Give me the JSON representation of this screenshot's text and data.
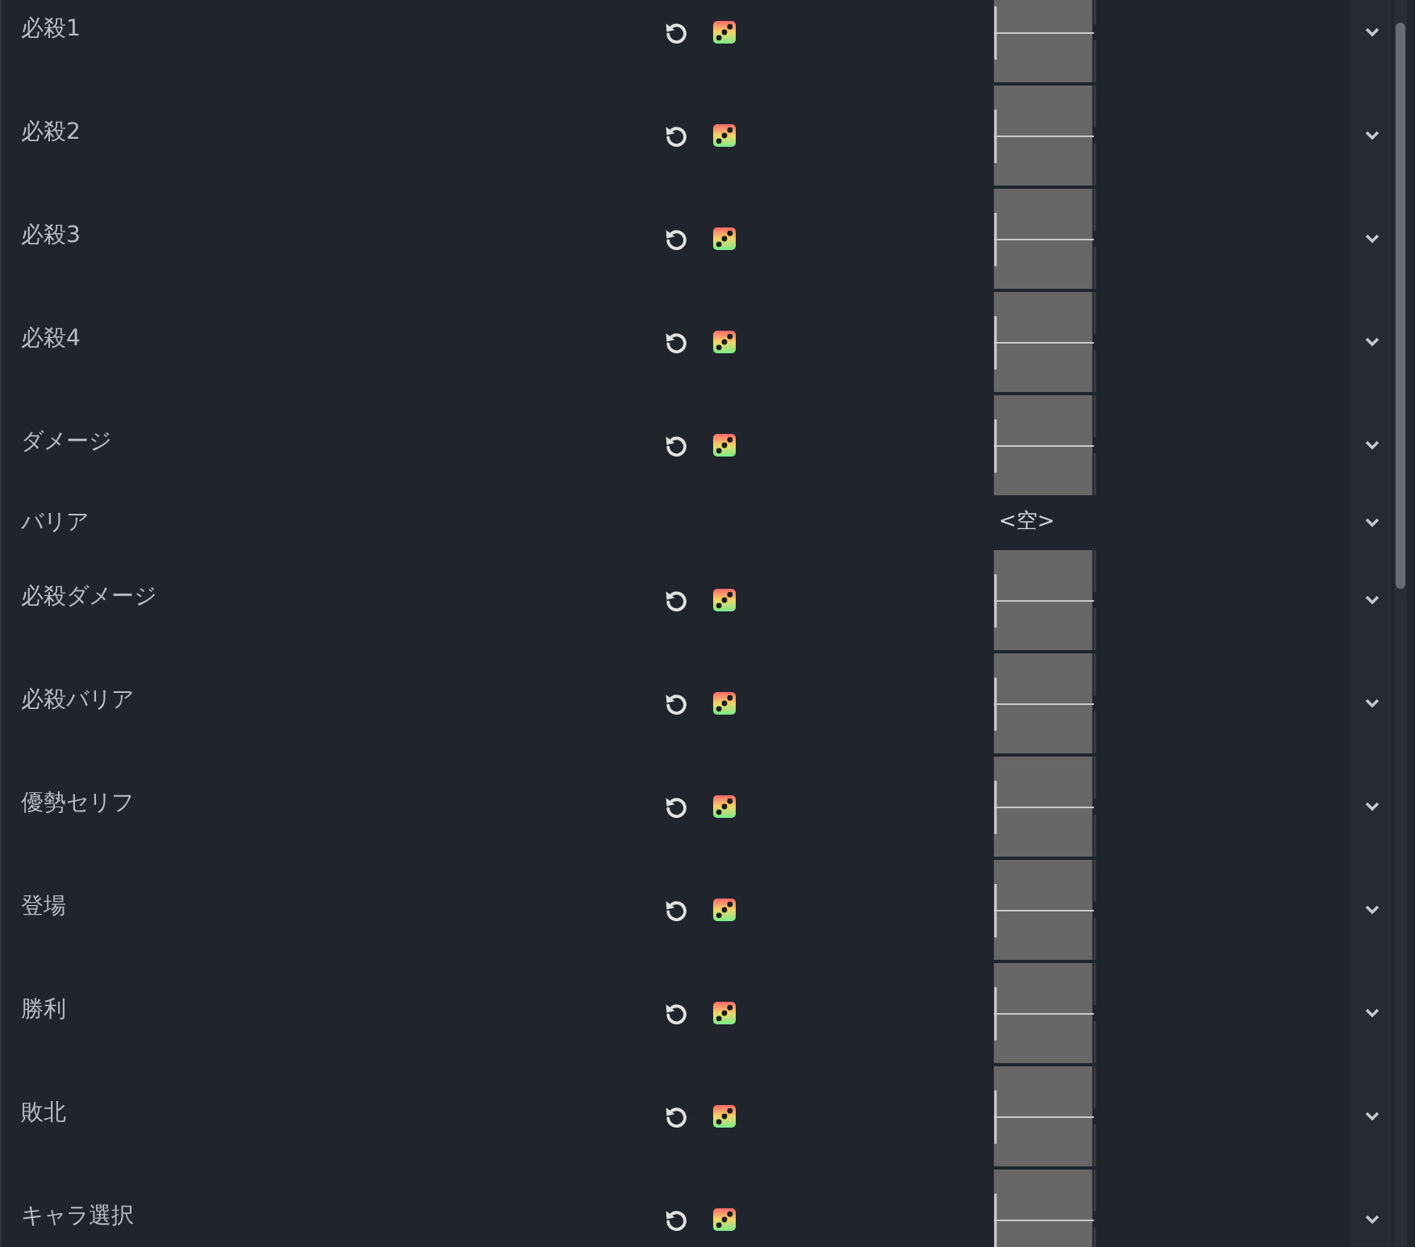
{
  "inspector": {
    "properties": [
      {
        "label": "必殺1",
        "kind": "stream"
      },
      {
        "label": "必殺2",
        "kind": "stream"
      },
      {
        "label": "必殺3",
        "kind": "stream"
      },
      {
        "label": "必殺4",
        "kind": "stream"
      },
      {
        "label": "ダメージ",
        "kind": "stream"
      },
      {
        "label": "バリア",
        "kind": "empty",
        "value": "<空>"
      },
      {
        "label": "必殺ダメージ",
        "kind": "stream"
      },
      {
        "label": "必殺バリア",
        "kind": "stream"
      },
      {
        "label": "優勢セリフ",
        "kind": "stream"
      },
      {
        "label": "登場",
        "kind": "stream"
      },
      {
        "label": "勝利",
        "kind": "stream"
      },
      {
        "label": "敗北",
        "kind": "stream"
      },
      {
        "label": "キャラ選択",
        "kind": "stream"
      }
    ]
  }
}
